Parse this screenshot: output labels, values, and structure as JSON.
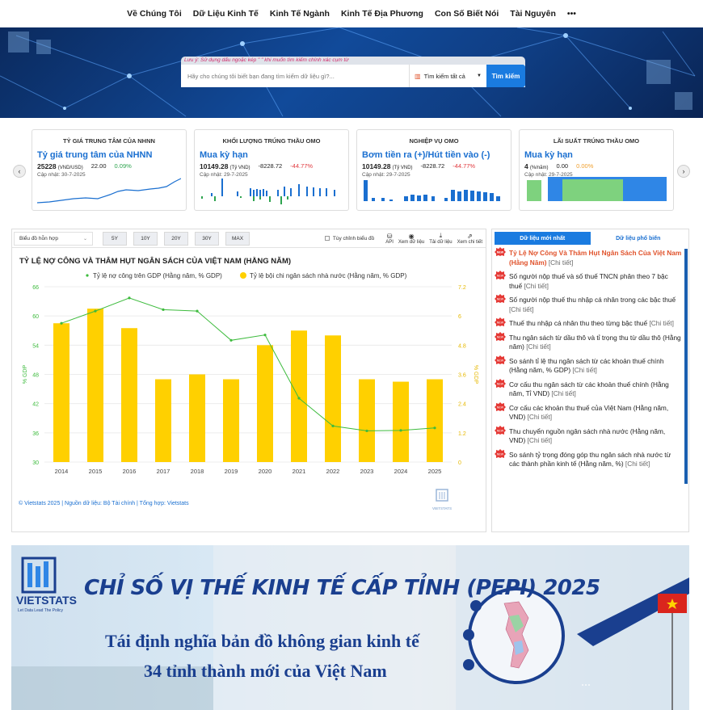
{
  "nav": {
    "items": [
      "Về Chúng Tôi",
      "Dữ Liệu Kinh Tế",
      "Kinh Tế Ngành",
      "Kinh Tế Địa Phương",
      "Con Số Biết Nói",
      "Tài Nguyên",
      "•••"
    ]
  },
  "search": {
    "note": "Lưu ý: Sử dụng dấu ngoặc kép \" \" khi muốn tìm kiếm chính xác cụm từ",
    "placeholder": "Hãy cho chúng tôi biết bạn đang tìm kiếm dữ liệu gì?...",
    "scope": "Tìm kiếm tất cả",
    "button": "Tìm kiếm"
  },
  "cards": [
    {
      "header": "TỶ GIÁ TRUNG TÂM CỦA NHNN",
      "title": "Tỷ giá trung tâm của NHNN",
      "value": "25228",
      "unit": "(VND/USD)",
      "change": "22.00",
      "pct": "0.09%",
      "pct_class": "pos",
      "updated": "Cập nhật: 30-7-2025",
      "spark": "line"
    },
    {
      "header": "KHỐI LƯỢNG TRÚNG THẦU OMO",
      "title": "Mua kỳ hạn",
      "value": "10149.28",
      "unit": "(Tỷ VND)",
      "change": "-8228.72",
      "pct": "-44.77%",
      "pct_class": "neg",
      "updated": "Cập nhật: 29-7-2025",
      "spark": "bars-mixed"
    },
    {
      "header": "NGHIỆP VỤ OMO",
      "title": "Bơm tiền ra (+)/Hút tiền vào (-)",
      "value": "10149.28",
      "unit": "(Tỷ VND)",
      "change": "-8228.72",
      "pct": "-44.77%",
      "pct_class": "neg",
      "updated": "Cập nhật: 29-7-2025",
      "spark": "bars-blue"
    },
    {
      "header": "LÃI SUẤT TRÚNG THẦU OMO",
      "title": "Mua kỳ hạn",
      "value": "4",
      "unit": "(%/năm)",
      "change": "0.00",
      "pct": "0.00%",
      "pct_class": "zero",
      "updated": "Cập nhật: 29-7-2025",
      "spark": "area"
    }
  ],
  "toolbar": {
    "chart_type": "Biểu đồ hỗn hợp",
    "ranges": [
      "5Y",
      "10Y",
      "20Y",
      "30Y",
      "MAX"
    ],
    "custom_label": "Tùy chỉnh biểu đồ",
    "tools": [
      "API",
      "Xem dữ liệu",
      "Tải dữ liệu",
      "Xem chi tiết"
    ]
  },
  "chart_data": {
    "type": "bar",
    "title": "TỶ LỆ NỢ CÔNG VÀ THÂM HỤT NGÂN SÁCH CỦA VIỆT NAM (HẰNG NĂM)",
    "categories": [
      "2014",
      "2015",
      "2016",
      "2017",
      "2018",
      "2019",
      "2020",
      "2021",
      "2022",
      "2023",
      "2024",
      "2025"
    ],
    "series": [
      {
        "name": "Tỷ lệ nợ công trên GDP (Hằng năm, % GDP)",
        "type": "line",
        "axis": "left",
        "color": "#3dbb3d",
        "values": [
          58.5,
          61.0,
          63.7,
          61.3,
          61.0,
          55.0,
          56.1,
          43.1,
          37.4,
          36.4,
          36.5,
          37.0
        ]
      },
      {
        "name": "Tỷ lệ bội chi ngân sách nhà nước (Hằng năm, % GDP)",
        "type": "bar",
        "axis": "right",
        "color": "#ffd000",
        "values": [
          5.7,
          6.3,
          5.5,
          3.4,
          3.6,
          3.4,
          4.8,
          5.4,
          5.2,
          3.4,
          3.3,
          3.4
        ]
      }
    ],
    "ylabel": "% GDP",
    "y2label": "% GDP",
    "ylim": [
      30,
      66
    ],
    "yticks": [
      30,
      36,
      42,
      48,
      54,
      60,
      66
    ],
    "y2lim": [
      0,
      7.2
    ],
    "y2ticks": [
      "0",
      "1.2",
      "2.4",
      "3.6",
      "4.8",
      "6",
      "7.2"
    ],
    "legend": "top",
    "grid": true
  },
  "chart_footnote": "© Vietstats 2025 | Nguồn dữ liệu: Bộ Tài chính | Tổng hợp: Vietstats",
  "watermark": "VIETSTATS",
  "side": {
    "tabs": [
      "Dữ liệu mới nhất",
      "Dữ liệu phổ biến"
    ],
    "more": "[Chi tiết]",
    "items": [
      "Tỷ Lệ Nợ Công Và Thâm Hụt Ngân Sách Của Việt Nam (Hằng Năm)",
      "Số người nộp thuế và số thuế TNCN phân theo 7 bậc thuế",
      "Số người nộp thuế thu nhập cá nhân trong các bậc thuế",
      "Thuế thu nhập cá nhân thu theo từng bậc thuế",
      "Thu ngân sách từ dầu thô và tỉ trọng thu từ dầu thô (Hằng năm)",
      "So sánh tỉ lệ thu ngân sách từ các khoản thuế chính (Hằng năm, % GDP)",
      "Cơ cấu thu ngân sách từ các khoản thuế chính (Hằng năm, Tỉ VND)",
      "Cơ cấu các khoản thu thuế của Việt Nam (Hằng năm, VND)",
      "Thu chuyển nguồn ngân sách nhà nước (Hằng năm, VND)",
      "So sánh tỷ trọng đóng góp thu ngân sách nhà nước từ các thành phần kinh tế (Hằng năm, %)"
    ]
  },
  "banner": {
    "title": "CHỈ SỐ VỊ THẾ KINH TẾ CẤP TỈNH  (PEPI) 2025",
    "line1": "Tái định nghĩa bản đồ không gian kinh tế",
    "line2": "34 tỉnh thành mới của Việt Nam",
    "logo": "VIETSTATS",
    "tagline": "Let Data Lead The Policy"
  },
  "colors": {
    "accent": "#1a7be0",
    "brand": "#1a3f8f",
    "line": "#3dbb3d",
    "bar": "#ffd000"
  }
}
